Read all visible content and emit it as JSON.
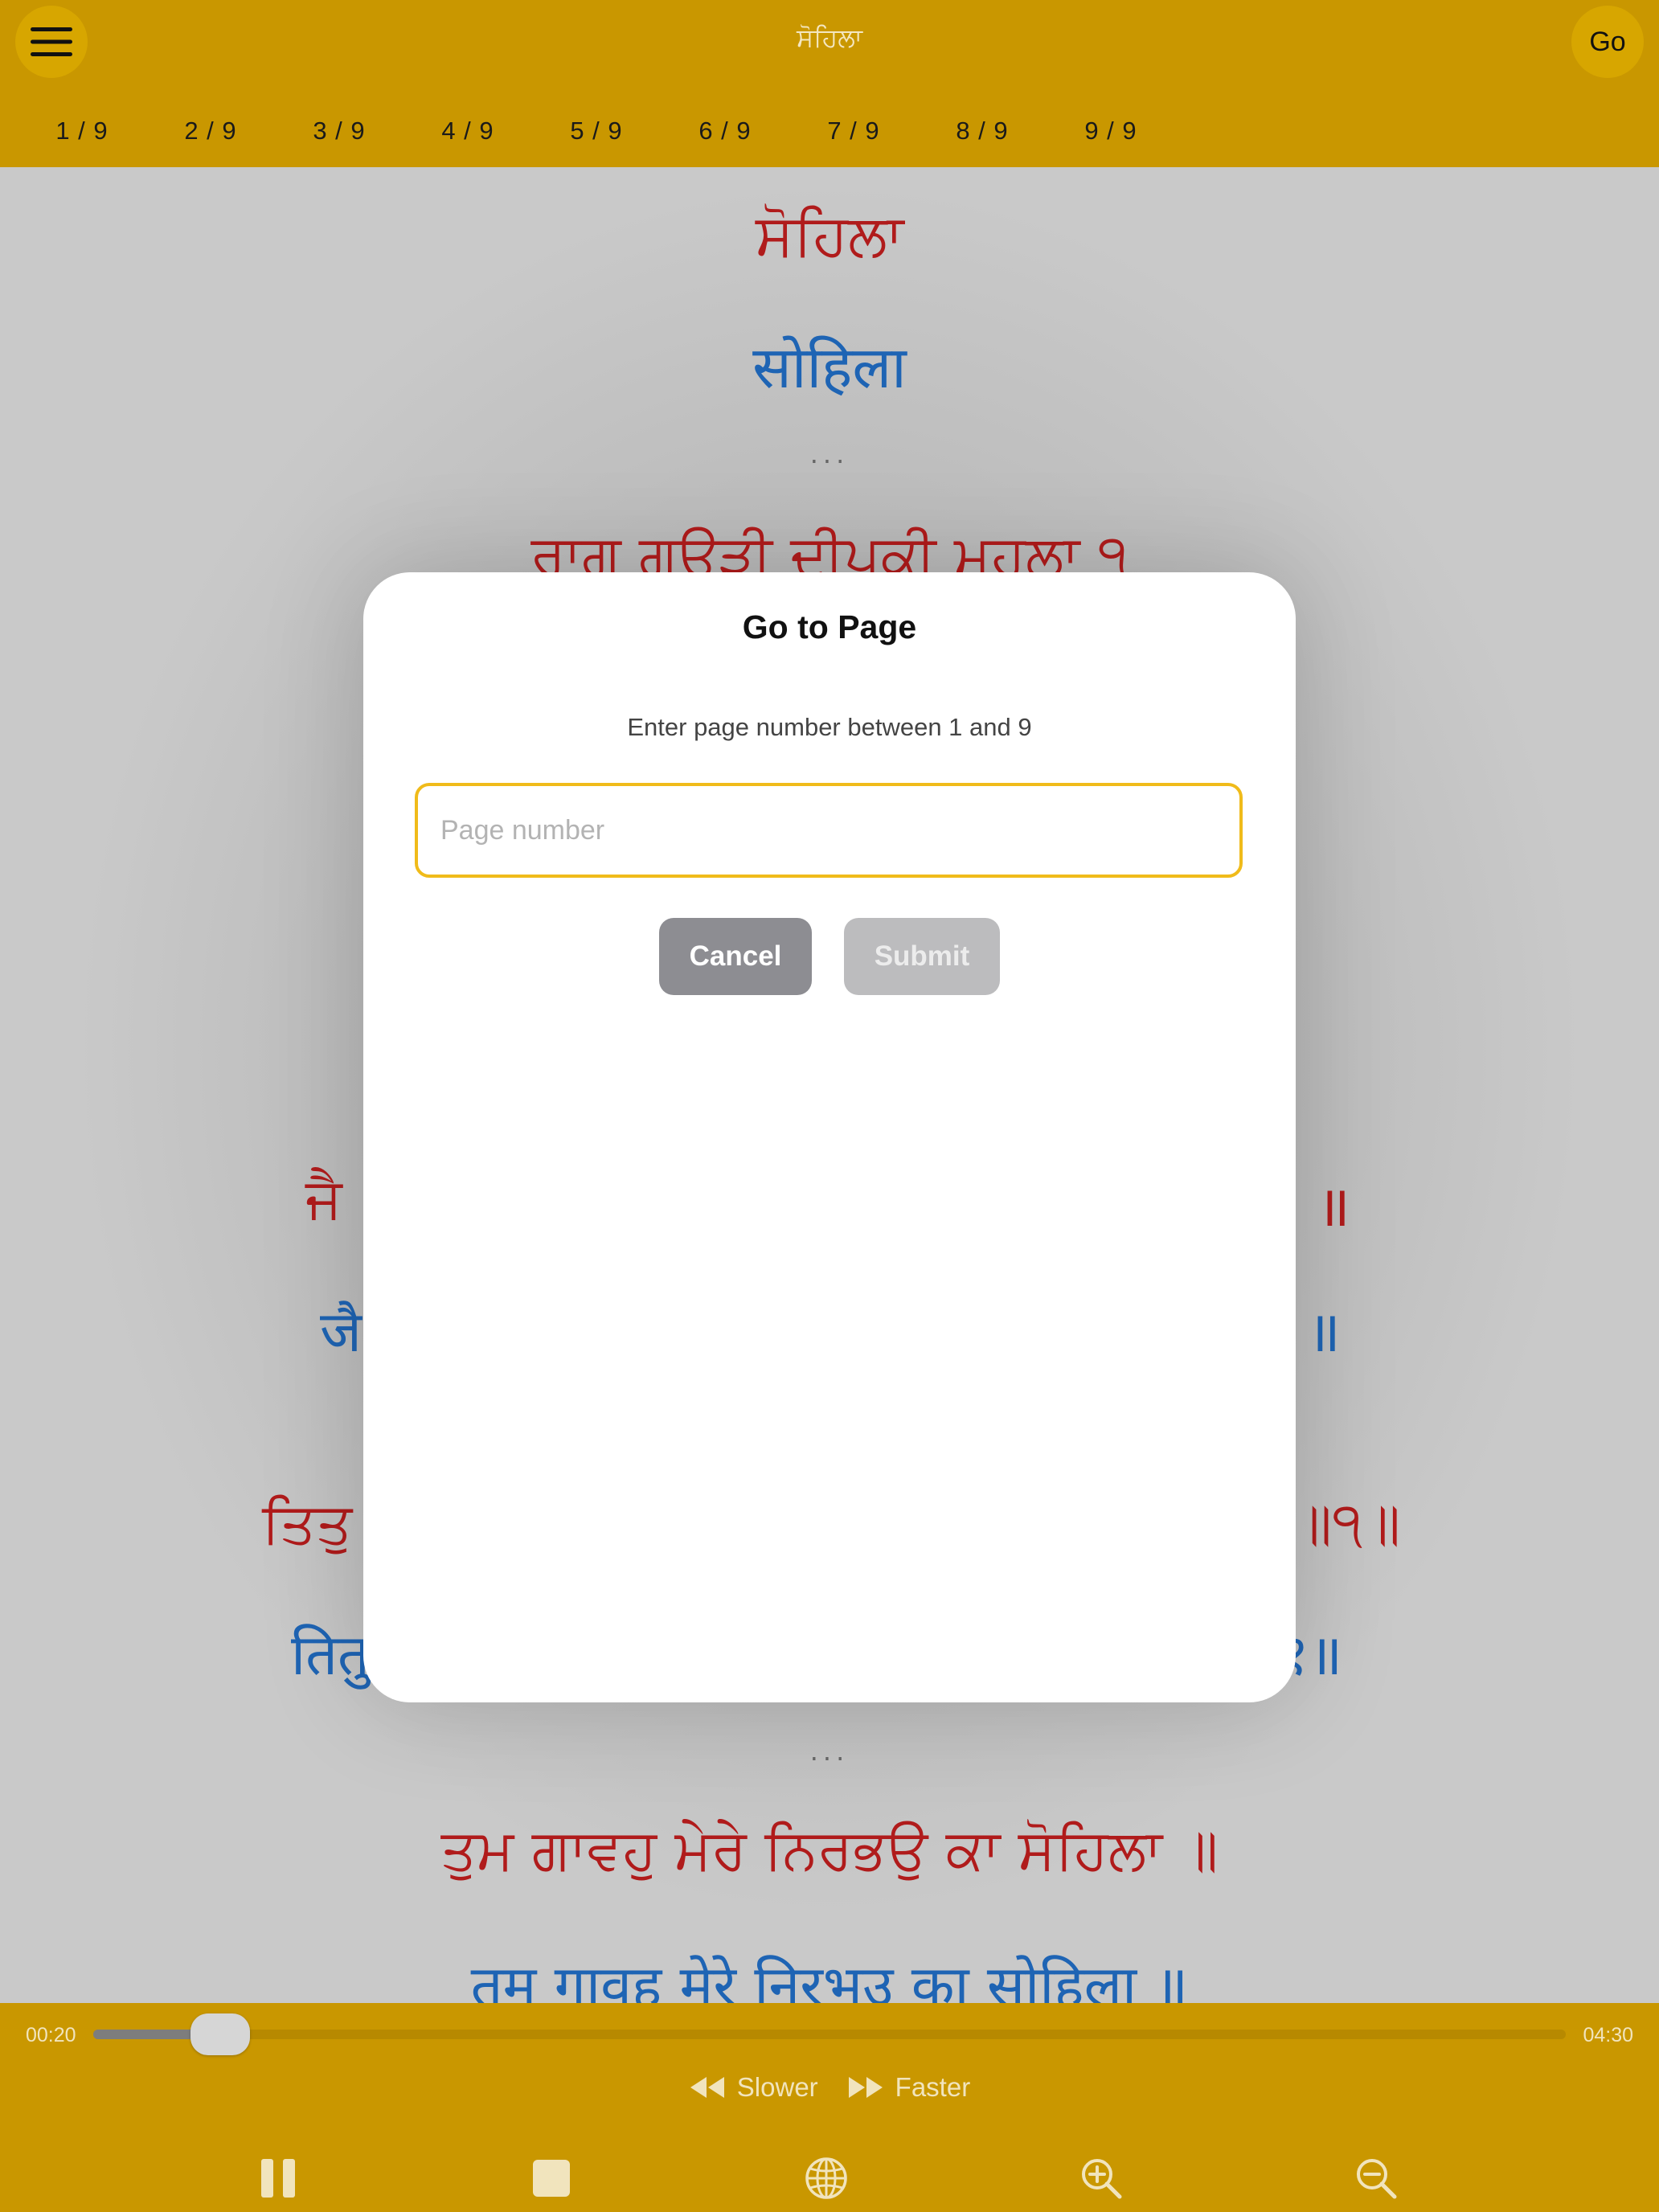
{
  "header": {
    "title": "ਸੋਹਿਲਾ",
    "go_label": "Go",
    "page_tabs": [
      "1 / 9",
      "2 / 9",
      "3 / 9",
      "4 / 9",
      "5 / 9",
      "6 / 9",
      "7 / 9",
      "8 / 9",
      "9 / 9"
    ]
  },
  "content": {
    "lines": [
      {
        "text": "ਸੋਹਿਲਾ",
        "lang": "gurmukhi"
      },
      {
        "text": "सोहिला",
        "lang": "devanagari"
      },
      {
        "text": "...",
        "lang": "separator"
      },
      {
        "text": "ਰਾਗੁ ਗਉੜੀ ਦੀਪਕੀ ਮਹਲਾ ੧",
        "lang": "gurmukhi"
      },
      {
        "text": "...",
        "lang": "separator"
      },
      {
        "text": "ਤੁਮ ਗਾਵਹੁ ਮੇਰੇ ਨਿਰਭਉ ਕਾ ਸੋਹਿਲਾ ॥",
        "lang": "gurmukhi"
      },
      {
        "text": "तुम गावहु मेरे निरभउ का सोहिला ॥",
        "lang": "devanagari"
      }
    ],
    "partial": {
      "jai_red_left": "ਜੈ",
      "jai_red_right": "॥",
      "jai_blue_left": "जै",
      "jai_blue_right": "॥",
      "titu_red_left": "ਤਿਤੁ",
      "titu_red_right": "॥੧॥",
      "titu_blue_left": "तितु",
      "titu_blue_right": "१॥"
    }
  },
  "dialog": {
    "title": "Go to Page",
    "subtitle": "Enter page number between 1 and 9",
    "input_placeholder": "Page number",
    "input_value": "",
    "cancel_label": "Cancel",
    "submit_label": "Submit"
  },
  "player": {
    "elapsed": "00:20",
    "duration": "04:30",
    "progress": 0.074,
    "slower_label": "Slower",
    "faster_label": "Faster"
  },
  "colors": {
    "accent": "#c99700",
    "gurmukhi_text": "#b01b1b",
    "devanagari_text": "#1e64b4",
    "input_border": "#f0bb1a"
  },
  "icons": {
    "menu": "hamburger-icon",
    "pause": "pause-icon",
    "stop": "stop-icon",
    "language": "globe-icon",
    "zoom_in": "zoom-in-icon",
    "zoom_out": "zoom-out-icon",
    "slower": "rewind-icon",
    "faster": "fast-forward-icon"
  }
}
